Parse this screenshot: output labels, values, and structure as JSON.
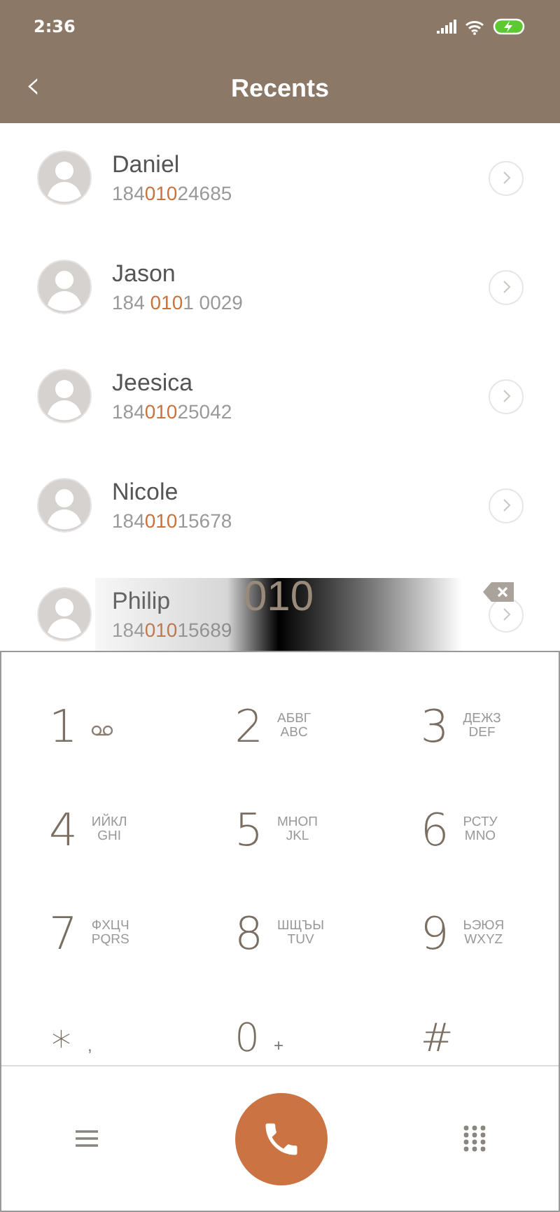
{
  "status_bar": {
    "time": "2:36"
  },
  "header": {
    "back": "‹",
    "title": "Recents"
  },
  "contacts": [
    {
      "name": "Daniel",
      "number_before": "184",
      "number_match": "010",
      "number_after": "24685"
    },
    {
      "name": "Jason",
      "number_before": "184 ",
      "number_match": "010",
      "number_after": "1 0029"
    },
    {
      "name": "Jeesica",
      "number_before": "184",
      "number_match": "010",
      "number_after": "25042"
    },
    {
      "name": "Nicole",
      "number_before": "184",
      "number_match": "010",
      "number_after": "15678"
    },
    {
      "name": "Philip",
      "number_before": "184",
      "number_match": "010",
      "number_after": "15689"
    }
  ],
  "dialed": "010",
  "keypad": [
    {
      "digit": "1",
      "kind": "voicemail"
    },
    {
      "digit": "2",
      "kind": "letters",
      "top": "АБВГ",
      "bottom": "ABC"
    },
    {
      "digit": "3",
      "kind": "letters",
      "top": "ДЕЖЗ",
      "bottom": "DEF"
    },
    {
      "digit": "4",
      "kind": "letters",
      "top": "ИЙКЛ",
      "bottom": "GHI"
    },
    {
      "digit": "5",
      "kind": "letters",
      "top": "МНОП",
      "bottom": "JKL"
    },
    {
      "digit": "6",
      "kind": "letters",
      "top": "РСТУ",
      "bottom": "MNO"
    },
    {
      "digit": "7",
      "kind": "letters",
      "top": "ФХЦЧ",
      "bottom": "PQRS"
    },
    {
      "digit": "8",
      "kind": "letters",
      "top": "ШЩЪЫ",
      "bottom": "TUV"
    },
    {
      "digit": "9",
      "kind": "letters",
      "top": "ЬЭЮЯ",
      "bottom": "WXYZ"
    },
    {
      "digit": "∗",
      "kind": "symbol",
      "extra": ","
    },
    {
      "digit": "0",
      "kind": "symbol",
      "extra": "+"
    },
    {
      "digit": "#",
      "kind": "symbol"
    }
  ]
}
